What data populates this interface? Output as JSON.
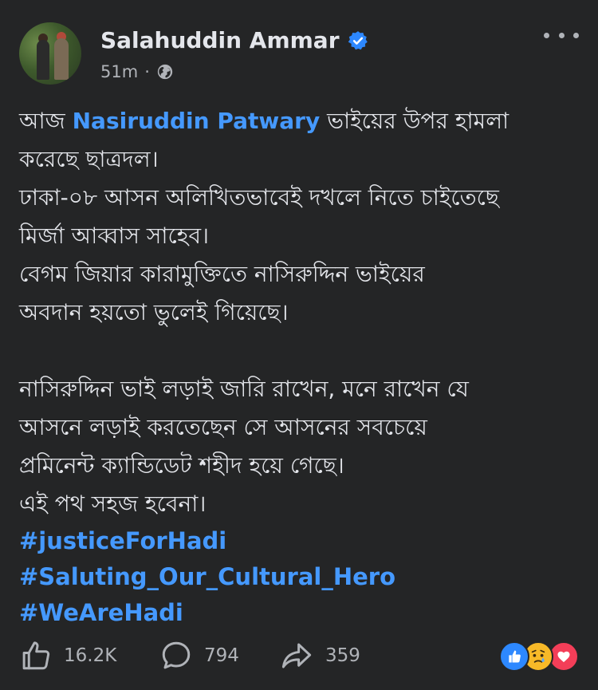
{
  "author": {
    "name": "Salahuddin Ammar",
    "time": "51m",
    "separator": "·"
  },
  "post": {
    "lines1": [
      {
        "before": "আজ ",
        "mention": "Nasiruddin Patwary",
        "after": " ভাইয়ের উপর হামলা"
      },
      {
        "text": "করেছে ছাত্রদল।"
      },
      {
        "text": "ঢাকা-০৮ আসন অলিখিতভাবেই দখলে নিতে চাইতেছে"
      },
      {
        "text": "মির্জা আব্বাস সাহেব।"
      },
      {
        "text": "বেগম জিয়ার কারামুক্তিতে নাসিরুদ্দিন ভাইয়ের"
      },
      {
        "text": "অবদান হয়তো ভুলেই গিয়েছে।"
      }
    ],
    "lines2": [
      "নাসিরুদ্দিন ভাই লড়াই জারি রাখেন, মনে রাখেন যে",
      "আসনে লড়াই করতেছেন সে আসনের সবচেয়ে",
      "প্রমিনেন্ট ক্যান্ডিডেট শহীদ হয়ে গেছে।",
      "এই পথ সহজ হবেনা।"
    ],
    "hashtags": [
      "#justiceForHadi",
      "#Saluting_Our_Cultural_Hero",
      "#WeAreHadi"
    ]
  },
  "actions": {
    "likes": "16.2K",
    "comments": "794",
    "shares": "359"
  },
  "colors": {
    "background": "#242526",
    "text": "#e4e6eb",
    "muted": "#b0b3b8",
    "link": "#4599ff"
  },
  "icons": [
    "verified-badge-icon",
    "globe-icon",
    "more-options-icon",
    "like-icon",
    "comment-icon",
    "share-icon",
    "like-reaction-icon",
    "sad-reaction-icon",
    "love-reaction-icon"
  ]
}
